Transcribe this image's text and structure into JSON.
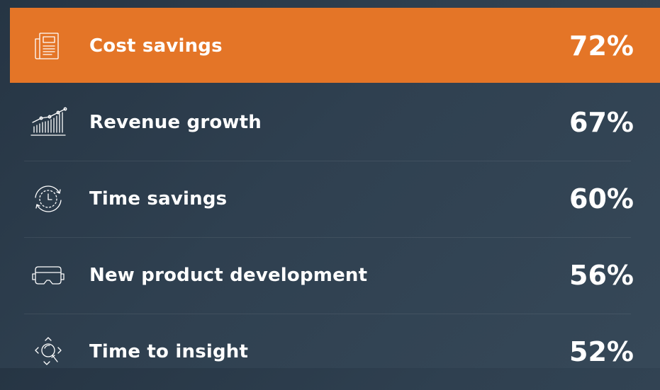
{
  "chart_data": {
    "type": "bar",
    "categories": [
      "Cost savings",
      "Revenue growth",
      "Time savings",
      "New product development",
      "Time to insight"
    ],
    "values": [
      72,
      67,
      60,
      56,
      52
    ],
    "value_labels": [
      "72%",
      "67%",
      "60%",
      "56%",
      "52%"
    ],
    "icons": [
      "newspaper-icon",
      "growth-chart-icon",
      "clock-cycle-icon",
      "vr-headset-icon",
      "magnifier-icon"
    ],
    "highlight_index": 0,
    "colors": {
      "highlight": "#e47527",
      "background": "#2f4050",
      "text": "#ffffff"
    }
  }
}
